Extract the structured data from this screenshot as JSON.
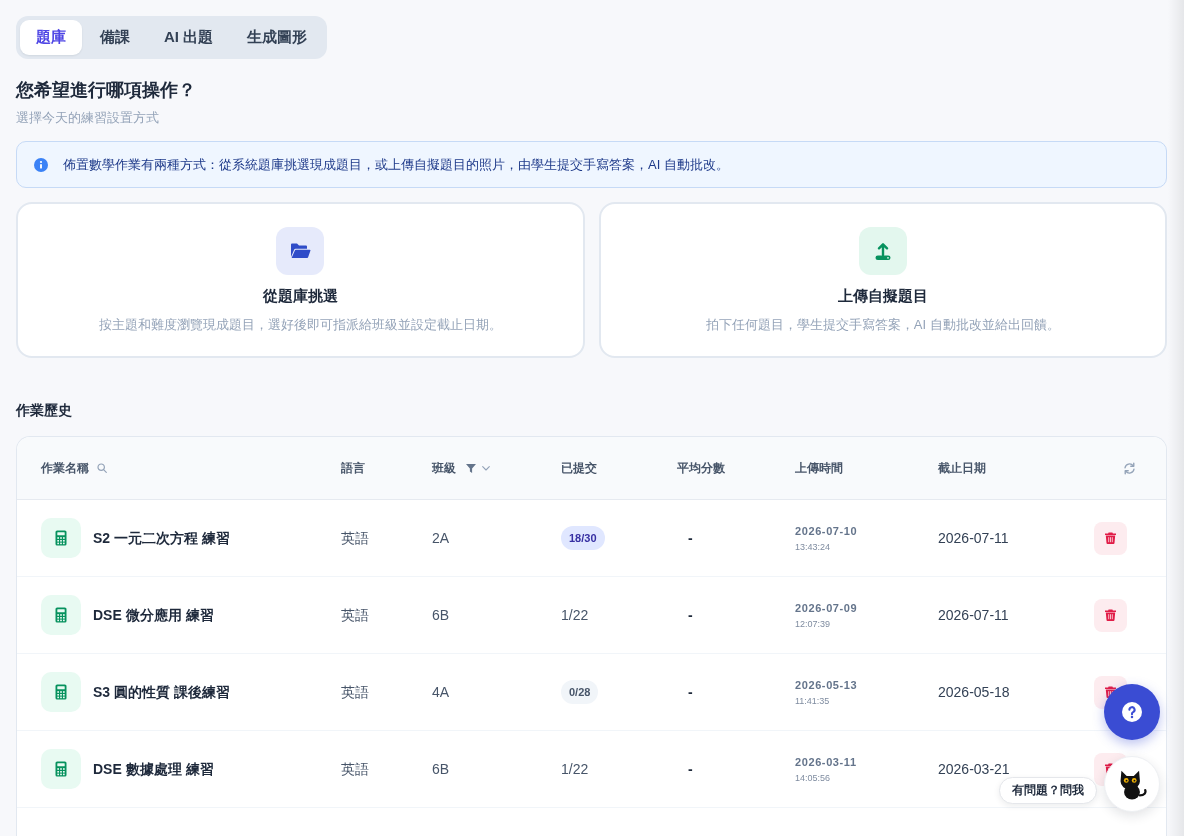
{
  "tabs": [
    {
      "label": "題庫",
      "selected": true
    },
    {
      "label": "備課",
      "selected": false
    },
    {
      "label": "AI 出題",
      "selected": false
    },
    {
      "label": "生成圖形",
      "selected": false
    }
  ],
  "header": {
    "title": "您希望進行哪項操作？",
    "subtitle": "選擇今天的練習設置方式"
  },
  "info_banner": {
    "text": "佈置數學作業有兩種方式：從系統題庫挑選現成題目，或上傳自擬題目的照片，由學生提交手寫答案，AI 自動批改。"
  },
  "options": [
    {
      "kind": "bank",
      "title": "從題庫挑選",
      "description": "按主題和難度瀏覽現成題目，選好後即可指派給班級並設定截止日期。"
    },
    {
      "kind": "upload",
      "title": "上傳自擬題目",
      "description": "拍下任何題目，學生提交手寫答案，AI 自動批改並給出回饋。"
    }
  ],
  "history": {
    "title": "作業歷史",
    "columns": [
      {
        "label": "作業名稱",
        "kind": "search"
      },
      {
        "label": "語言",
        "kind": "plain"
      },
      {
        "label": "班級",
        "kind": "filter"
      },
      {
        "label": "已提交",
        "kind": "plain"
      },
      {
        "label": "平均分數",
        "kind": "plain"
      },
      {
        "label": "上傳時間",
        "kind": "plain"
      },
      {
        "label": "截止日期",
        "kind": "plain"
      }
    ],
    "rows": [
      {
        "name": "S2 一元二次方程 練習",
        "language": "英語",
        "class": "2A",
        "submitted": {
          "text": "18/30",
          "kind": "accent"
        },
        "average": "-",
        "uploaded_date": "2026-07-10",
        "uploaded_time": "13:43:24",
        "due": "2026-07-11"
      },
      {
        "name": "DSE 微分應用 練習",
        "language": "英語",
        "class": "6B",
        "submitted": {
          "text": "1/22",
          "kind": "plain"
        },
        "average": "-",
        "uploaded_date": "2026-07-09",
        "uploaded_time": "12:07:39",
        "due": "2026-07-11"
      },
      {
        "name": "S3 圓的性質 課後練習",
        "language": "英語",
        "class": "4A",
        "submitted": {
          "text": "0/28",
          "kind": "muted"
        },
        "average": "-",
        "uploaded_date": "2026-05-13",
        "uploaded_time": "11:41:35",
        "due": "2026-05-18"
      },
      {
        "name": "DSE 數據處理 練習",
        "language": "英語",
        "class": "6B",
        "submitted": {
          "text": "1/22",
          "kind": "plain"
        },
        "average": "-",
        "uploaded_date": "2026-03-11",
        "uploaded_time": "14:05:56",
        "due": "2026-03-21"
      }
    ]
  },
  "assistant": {
    "chat_label": "有問題？問我"
  }
}
